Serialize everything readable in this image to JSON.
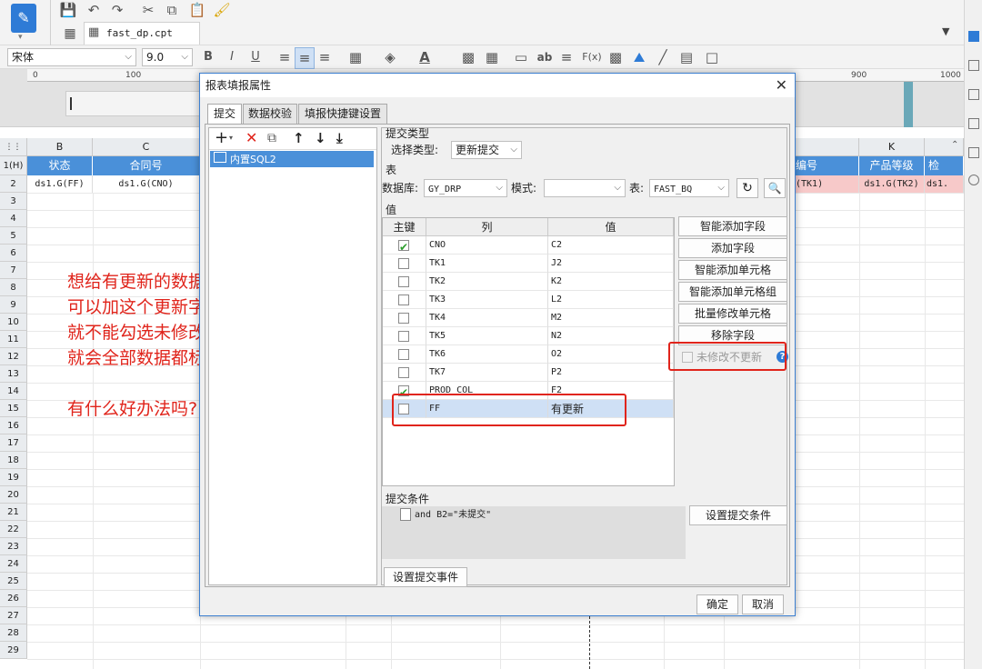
{
  "toolbar": {
    "file_name": "fast_dp.cpt",
    "font_name": "宋体",
    "font_size": "9.0",
    "bold": "B",
    "italic": "I",
    "underline": "U",
    "ab_label": "ab",
    "fx_label": "F(x)"
  },
  "ruler": {
    "ticks": [
      "0",
      "100",
      "900",
      "1000"
    ]
  },
  "sheet": {
    "columns": [
      {
        "label": "B"
      },
      {
        "label": "C"
      },
      {
        "label": "K"
      }
    ],
    "header_row_label": "1(H)",
    "header_cells": [
      "状态",
      "合同号",
      "编号",
      "产品等级",
      "检"
    ],
    "data_cells": [
      "ds1.G(FF)",
      "ds1.G(CNO)",
      "(TK1)",
      "ds1.G(TK2)",
      "ds1."
    ],
    "row_numbers": [
      "2",
      "3",
      "4",
      "5",
      "6",
      "7",
      "8",
      "9",
      "10",
      "11",
      "12",
      "13",
      "14",
      "15",
      "16",
      "17",
      "18",
      "19",
      "20",
      "21",
      "22",
      "23",
      "24",
      "25",
      "26",
      "27",
      "28",
      "29"
    ]
  },
  "annotation": {
    "lines": [
      "想给有更新的数据做个标记",
      "可以加这个更新字段",
      "就不能勾选未修改不更新的选项",
      "就会全部数据都标记了",
      "",
      "有什么好办法吗?"
    ],
    "color": "#e0241b"
  },
  "dialog": {
    "title": "报表填报属性",
    "close": "✕",
    "tabs": [
      "提交",
      "数据校验",
      "填报快捷键设置"
    ],
    "tree_item": "内置SQL2",
    "submit_type_section": "提交类型",
    "select_type_label": "选择类型:",
    "select_type_value": "更新提交",
    "table_section": "表",
    "database_label": "数据库:",
    "database_value": "GY_DRP",
    "schema_label": "模式:",
    "schema_value": "",
    "table_label": "表:",
    "table_value": "FAST_BQ",
    "value_section": "值",
    "table_headers": [
      "主键",
      "列",
      "值"
    ],
    "rows": [
      {
        "key": true,
        "column": "CNO",
        "value": "C2"
      },
      {
        "key": false,
        "column": "TK1",
        "value": "J2"
      },
      {
        "key": false,
        "column": "TK2",
        "value": "K2"
      },
      {
        "key": false,
        "column": "TK3",
        "value": "L2"
      },
      {
        "key": false,
        "column": "TK4",
        "value": "M2"
      },
      {
        "key": false,
        "column": "TK5",
        "value": "N2"
      },
      {
        "key": false,
        "column": "TK6",
        "value": "O2"
      },
      {
        "key": false,
        "column": "TK7",
        "value": "P2"
      },
      {
        "key": true,
        "column": "PROD_COL",
        "value": "F2"
      },
      {
        "key": false,
        "column": "FF",
        "value": "有更新"
      }
    ],
    "side_buttons": [
      "智能添加字段",
      "添加字段",
      "智能添加单元格",
      "智能添加单元格组",
      "批量修改单元格",
      "移除字段"
    ],
    "no_update_label": "未修改不更新",
    "help_icon": "?",
    "condition_section": "提交条件",
    "condition_text": "and B2=\"未提交\"",
    "set_condition_button": "设置提交条件",
    "set_event_button": "设置提交事件",
    "ok_button": "确定",
    "cancel_button": "取消"
  }
}
